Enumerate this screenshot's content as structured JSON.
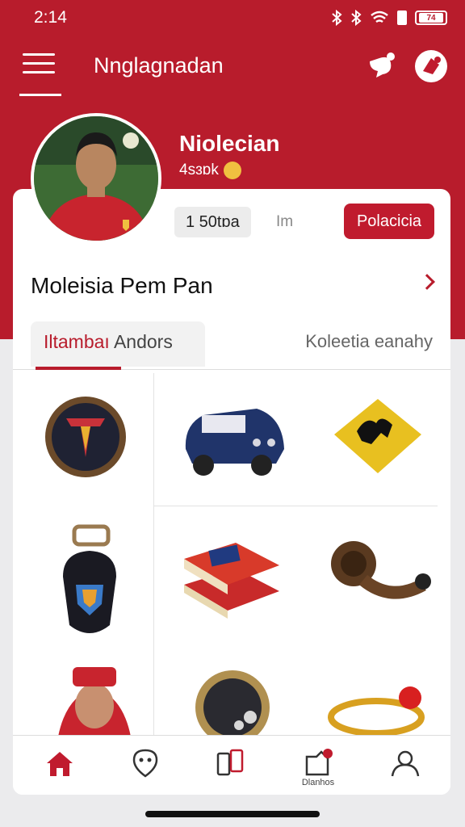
{
  "status": {
    "time": "2:14",
    "battery": "74"
  },
  "appbar": {
    "title": "Nnglagnadan"
  },
  "profile": {
    "name": "Niolecian",
    "meta": "4sɜɒk",
    "chip": "1 50tɒa",
    "chip_suffix": "Im",
    "action": "Polacicia"
  },
  "section": {
    "title": "Moleisia Pem Pan"
  },
  "tabs": {
    "active_hl": "Iltambaı",
    "active_rest": " Andors",
    "other": "Koleetia eanahy"
  },
  "nav": {
    "notif_label": "Dlanhos"
  },
  "colors": {
    "primary": "#b81c2c"
  }
}
